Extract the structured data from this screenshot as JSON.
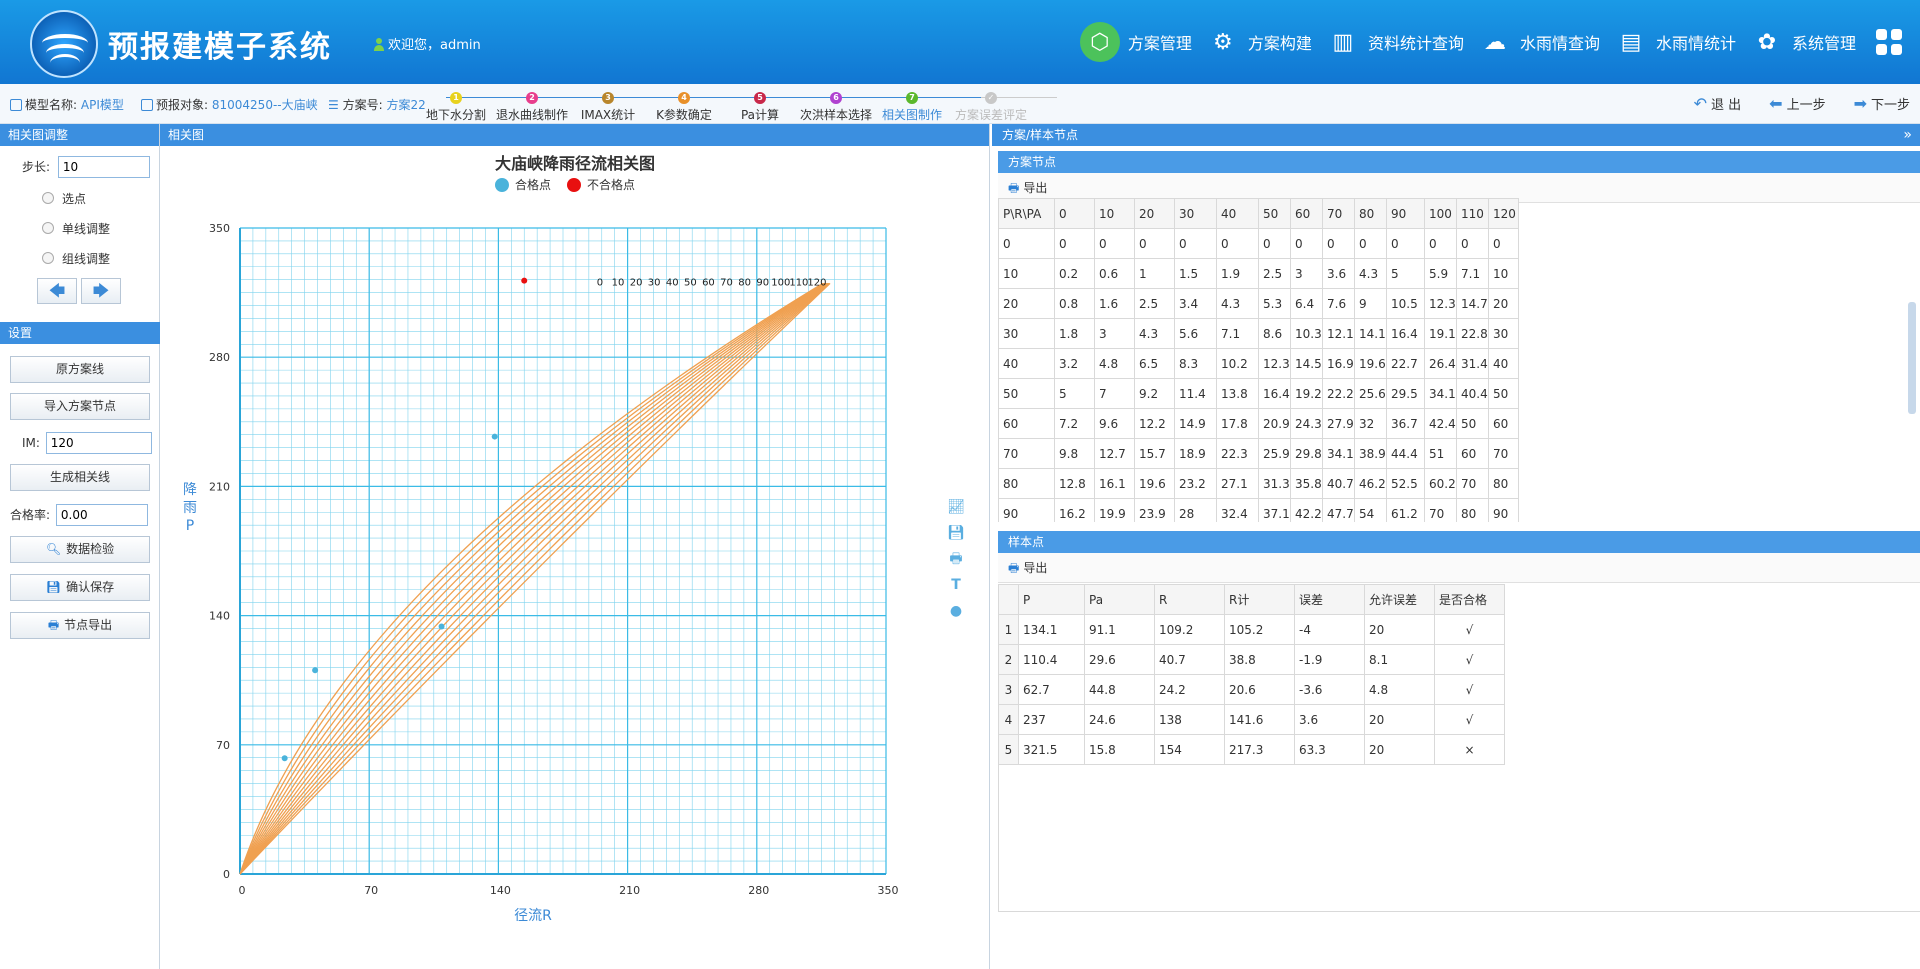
{
  "header": {
    "app_title": "预报建模子系统",
    "welcome": "欢迎您，admin",
    "nav": [
      {
        "label": "方案管理",
        "icon": "cube-icon",
        "active": true
      },
      {
        "label": "方案构建",
        "icon": "gear-icon"
      },
      {
        "label": "资料统计查询",
        "icon": "chart-search-icon"
      },
      {
        "label": "水雨情查询",
        "icon": "cloud-search-icon"
      },
      {
        "label": "水雨情统计",
        "icon": "bar-chart-icon"
      },
      {
        "label": "系统管理",
        "icon": "flower-gear-icon"
      }
    ]
  },
  "stepbar": {
    "model_label": "模型名称:",
    "model_value": "API模型",
    "target_label": "预报对象:",
    "target_value": "81004250--大庙峡",
    "plan_label": "方案号:",
    "plan_value": "方案22",
    "steps": [
      {
        "num": "1",
        "label": "地下水分割",
        "color": "#e8d21e"
      },
      {
        "num": "2",
        "label": "退水曲线制作",
        "color": "#e83e8c"
      },
      {
        "num": "3",
        "label": "IMAX统计",
        "color": "#b8862c"
      },
      {
        "num": "4",
        "label": "K参数确定",
        "color": "#e8902a"
      },
      {
        "num": "5",
        "label": "Pa计算",
        "color": "#c8284a"
      },
      {
        "num": "6",
        "label": "次洪样本选择",
        "color": "#b042d0"
      },
      {
        "num": "7",
        "label": "相关图制作",
        "color": "#5bb82c"
      },
      {
        "num": "✓",
        "label": "方案误差评定",
        "color": "#c8c8c8"
      }
    ],
    "exit": "退 出",
    "prev": "上一步",
    "next": "下一步"
  },
  "left": {
    "adjust_title": "相关图调整",
    "step_label": "步长:",
    "step_value": "10",
    "radio_select": "选点",
    "radio_single": "单线调整",
    "radio_group": "组线调整",
    "settings_title": "设置",
    "btn_original": "原方案线",
    "btn_import": "导入方案节点",
    "im_label": "IM:",
    "im_value": "120",
    "btn_generate": "生成相关线",
    "pass_label": "合格率:",
    "pass_value": "0.00",
    "btn_check": "数据检验",
    "btn_save": "确认保存",
    "btn_export": "节点导出"
  },
  "chart_panel": {
    "title": "相关图"
  },
  "chart_data": {
    "type": "line",
    "title": "大庙峡降雨径流相关图",
    "xlabel": "径流R",
    "ylabel": "降雨P",
    "xlim": [
      0,
      350
    ],
    "ylim": [
      0,
      350
    ],
    "xticks": [
      0,
      70,
      140,
      210,
      280,
      350
    ],
    "yticks": [
      0,
      70,
      140,
      210,
      280,
      350
    ],
    "legend": [
      "合格点",
      "不合格点"
    ],
    "line_color": "#f0a050",
    "pass_color": "#4ab3db",
    "fail_color": "#e81010",
    "curve_labels": [
      "0",
      "10",
      "20",
      "30",
      "40",
      "50",
      "60",
      "70",
      "80",
      "90",
      "100",
      "110",
      "120"
    ],
    "curves_pa": [
      0,
      10,
      20,
      30,
      40,
      50,
      60,
      70,
      80,
      90,
      100,
      110,
      120
    ],
    "pass_points": [
      {
        "x": 109.2,
        "y": 134.1
      },
      {
        "x": 40.7,
        "y": 110.4
      },
      {
        "x": 24.2,
        "y": 62.7
      },
      {
        "x": 138,
        "y": 237
      }
    ],
    "fail_points": [
      {
        "x": 154,
        "y": 321.5
      }
    ]
  },
  "right": {
    "title": "方案/样本节点",
    "nodes_title": "方案节点",
    "export": "导出",
    "nodes_header": [
      "P\\R\\PA",
      "0",
      "10",
      "20",
      "30",
      "40",
      "50",
      "60",
      "70",
      "80",
      "90",
      "100",
      "110",
      "120"
    ],
    "nodes_rows": [
      [
        "0",
        "0",
        "0",
        "0",
        "0",
        "0",
        "0",
        "0",
        "0",
        "0",
        "0",
        "0",
        "0",
        "0"
      ],
      [
        "10",
        "0.2",
        "0.6",
        "1",
        "1.5",
        "1.9",
        "2.5",
        "3",
        "3.6",
        "4.3",
        "5",
        "5.9",
        "7.1",
        "10"
      ],
      [
        "20",
        "0.8",
        "1.6",
        "2.5",
        "3.4",
        "4.3",
        "5.3",
        "6.4",
        "7.6",
        "9",
        "10.5",
        "12.3",
        "14.7",
        "20"
      ],
      [
        "30",
        "1.8",
        "3",
        "4.3",
        "5.6",
        "7.1",
        "8.6",
        "10.3",
        "12.1",
        "14.1",
        "16.4",
        "19.1",
        "22.8",
        "30"
      ],
      [
        "40",
        "3.2",
        "4.8",
        "6.5",
        "8.3",
        "10.2",
        "12.3",
        "14.5",
        "16.9",
        "19.6",
        "22.7",
        "26.4",
        "31.4",
        "40"
      ],
      [
        "50",
        "5",
        "7",
        "9.2",
        "11.4",
        "13.8",
        "16.4",
        "19.2",
        "22.2",
        "25.6",
        "29.5",
        "34.1",
        "40.4",
        "50"
      ],
      [
        "60",
        "7.2",
        "9.6",
        "12.2",
        "14.9",
        "17.8",
        "20.9",
        "24.3",
        "27.9",
        "32",
        "36.7",
        "42.4",
        "50",
        "60"
      ],
      [
        "70",
        "9.8",
        "12.7",
        "15.7",
        "18.9",
        "22.3",
        "25.9",
        "29.8",
        "34.1",
        "38.9",
        "44.4",
        "51",
        "60",
        "70"
      ],
      [
        "80",
        "12.8",
        "16.1",
        "19.6",
        "23.2",
        "27.1",
        "31.3",
        "35.8",
        "40.7",
        "46.2",
        "52.5",
        "60.2",
        "70",
        "80"
      ],
      [
        "90",
        "16.2",
        "19.9",
        "23.9",
        "28",
        "32.4",
        "37.1",
        "42.2",
        "47.7",
        "54",
        "61.2",
        "70",
        "80",
        "90"
      ]
    ],
    "samples_title": "样本点",
    "samples_header": [
      "",
      "P",
      "Pa",
      "R",
      "R计",
      "误差",
      "允许误差",
      "是否合格"
    ],
    "samples_rows": [
      [
        "1",
        "134.1",
        "91.1",
        "109.2",
        "105.2",
        "-4",
        "20",
        "√"
      ],
      [
        "2",
        "110.4",
        "29.6",
        "40.7",
        "38.8",
        "-1.9",
        "8.1",
        "√"
      ],
      [
        "3",
        "62.7",
        "44.8",
        "24.2",
        "20.6",
        "-3.6",
        "4.8",
        "√"
      ],
      [
        "4",
        "237",
        "24.6",
        "138",
        "141.6",
        "3.6",
        "20",
        "√"
      ],
      [
        "5",
        "321.5",
        "15.8",
        "154",
        "217.3",
        "63.3",
        "20",
        "×"
      ]
    ]
  }
}
